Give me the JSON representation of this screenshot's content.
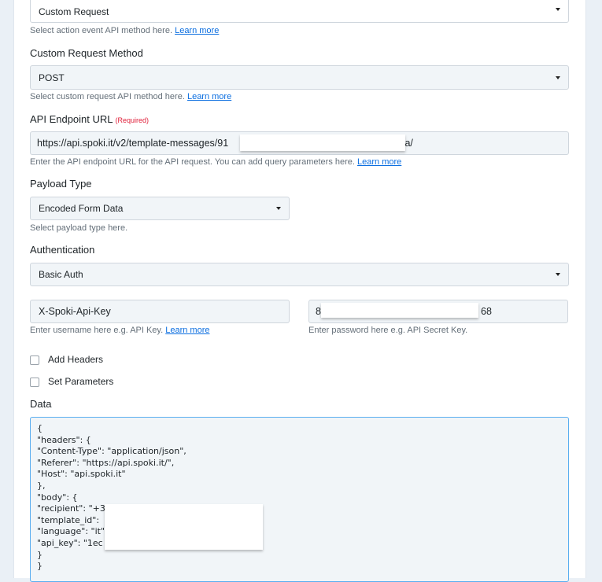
{
  "action_event": {
    "value": "Custom Request",
    "help": "Select action event API method here.",
    "link": "Learn more"
  },
  "request_method": {
    "label": "Custom Request Method",
    "value": "POST",
    "help": "Select custom request API method here.",
    "link": "Learn more"
  },
  "endpoint": {
    "label": "API Endpoint URL",
    "required": "(Required)",
    "value_start": "https://api.spoki.it/v2/template-messages/91",
    "value_end": "ta/",
    "help": "Enter the API endpoint URL for the API request. You can add query parameters here.",
    "link": "Learn more"
  },
  "payload_type": {
    "label": "Payload Type",
    "value": "Encoded Form Data",
    "help": "Select payload type here."
  },
  "authentication": {
    "label": "Authentication",
    "value": "Basic Auth",
    "username": {
      "value": "X-Spoki-Api-Key",
      "help": "Enter username here e.g. API Key.",
      "link": "Learn more"
    },
    "password": {
      "value_start": "8",
      "value_end": "68",
      "help": "Enter password here e.g. API Secret Key."
    }
  },
  "checkboxes": [
    {
      "label": "Add Headers",
      "checked": false
    },
    {
      "label": "Set Parameters",
      "checked": false
    }
  ],
  "data": {
    "label": "Data",
    "value": "{\n\"headers\": {\n\"Content-Type\": \"application/json\",\n\"Referer\": \"https://api.spoki.it/\",\n\"Host\": \"api.spoki.it\"\n},\n\"body\": {\n\"recipient\": \"+3\n\"template_id\":\n\"language\": \"it\"\n\"api_key\": \"1ec                                         5\"\n}\n}"
  }
}
